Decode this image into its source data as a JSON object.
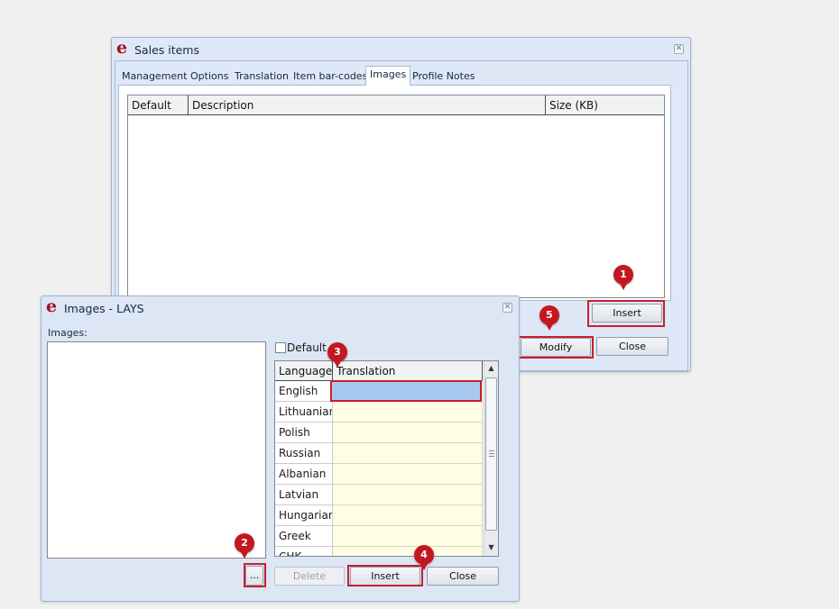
{
  "sales_window": {
    "title": "Sales items",
    "tabs": [
      {
        "label": "Management"
      },
      {
        "label": "Options"
      },
      {
        "label": "Translation"
      },
      {
        "label": "Item bar-codes"
      },
      {
        "label": "Images"
      },
      {
        "label": "Profile Notes"
      }
    ],
    "active_tab": "Images",
    "columns": [
      {
        "label": "Default"
      },
      {
        "label": "Description"
      },
      {
        "label": "Size (KB)"
      }
    ],
    "buttons": {
      "insert": "Insert",
      "modify": "Modify",
      "close": "Close"
    }
  },
  "images_window": {
    "title": "Images - LAYS",
    "images_label": "Images:",
    "default_label": "Default",
    "default_checked": false,
    "columns": [
      {
        "label": "Language"
      },
      {
        "label": "Translation"
      }
    ],
    "rows": [
      {
        "language": "English",
        "translation": "",
        "selected": true
      },
      {
        "language": "Lithuanian",
        "translation": ""
      },
      {
        "language": "Polish",
        "translation": ""
      },
      {
        "language": "Russian",
        "translation": ""
      },
      {
        "language": "Albanian",
        "translation": ""
      },
      {
        "language": "Latvian",
        "translation": ""
      },
      {
        "language": "Hungarian",
        "translation": ""
      },
      {
        "language": "Greek",
        "translation": ""
      },
      {
        "language": "CHK",
        "translation": ""
      }
    ],
    "buttons": {
      "browse": "...",
      "delete": "Delete",
      "insert": "Insert",
      "close": "Close"
    }
  },
  "callouts": [
    {
      "number": "1"
    },
    {
      "number": "2"
    },
    {
      "number": "3"
    },
    {
      "number": "4"
    },
    {
      "number": "5"
    }
  ],
  "colors": {
    "callout": "#c4171f",
    "selected_cell": "#a7c8ee",
    "editable_cell": "#fffde3"
  },
  "icons": {
    "app": "e-logo",
    "close": "close-icon",
    "scroll_up": "arrow-up",
    "scroll_down": "arrow-down"
  }
}
